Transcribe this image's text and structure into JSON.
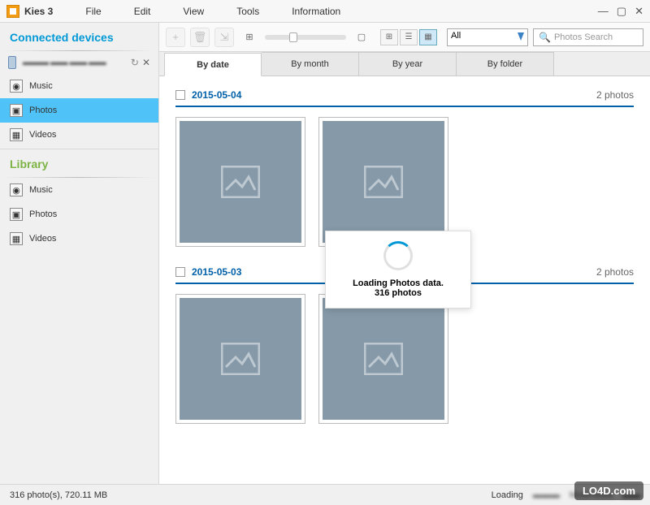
{
  "app": {
    "title": "Kies 3"
  },
  "menu": {
    "file": "File",
    "edit": "Edit",
    "view": "View",
    "tools": "Tools",
    "info": "Information"
  },
  "window": {
    "min": "—",
    "max": "▢",
    "close": "✕"
  },
  "sidebar": {
    "connected_header": "Connected devices",
    "library_header": "Library",
    "device_name": "▬▬▬ ▬▬ ▬▬ ▬▬",
    "refresh": "↻",
    "close": "✕",
    "connected": [
      {
        "label": "Music",
        "icon": "disc"
      },
      {
        "label": "Photos",
        "icon": "photo",
        "selected": true
      },
      {
        "label": "Videos",
        "icon": "film"
      }
    ],
    "library": [
      {
        "label": "Music",
        "icon": "disc"
      },
      {
        "label": "Photos",
        "icon": "photo"
      },
      {
        "label": "Videos",
        "icon": "film"
      }
    ]
  },
  "toolbar": {
    "add": "+",
    "delete": "🗑",
    "import": "⇲",
    "filter_value": "All",
    "search_placeholder": "Photos Search"
  },
  "tabs": [
    {
      "label": "By date",
      "active": true
    },
    {
      "label": "By month"
    },
    {
      "label": "By year"
    },
    {
      "label": "By folder"
    }
  ],
  "groups": [
    {
      "date": "2015-05-04",
      "count": "2 photos",
      "thumbs": 2
    },
    {
      "date": "2015-05-03",
      "count": "2 photos",
      "thumbs": 2
    }
  ],
  "loading": {
    "line1": "Loading Photos data.",
    "line2": "316 photos"
  },
  "status": {
    "left": "316 photo(s), 720.11 MB",
    "loading": "Loading",
    "multimedia": "Multimedia"
  },
  "watermark": "LO4D.com"
}
